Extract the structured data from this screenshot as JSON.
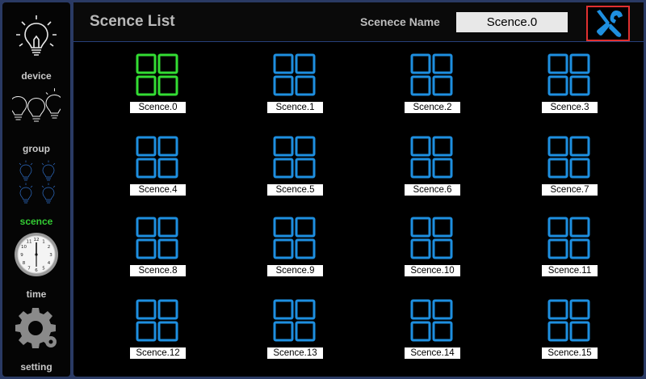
{
  "sidebar": {
    "items": [
      {
        "id": "device",
        "label": "device",
        "icon": "bulb-icon"
      },
      {
        "id": "group",
        "label": "group",
        "icon": "bulbs-group-icon"
      },
      {
        "id": "scence",
        "label": "scence",
        "icon": "scene-bulbs-icon"
      },
      {
        "id": "time",
        "label": "time",
        "icon": "clock-icon"
      },
      {
        "id": "setting",
        "label": "setting",
        "icon": "gear-icon"
      }
    ],
    "active": "scence"
  },
  "header": {
    "title": "Scence List",
    "name_label": "Scenece Name",
    "name_value": "Scence.0",
    "tools_icon": "tools-icon"
  },
  "colors": {
    "active_green": "#33cc33",
    "scene_blue": "#1e8fe0",
    "selected_scene": "#33dd33",
    "tools_border": "#e03030"
  },
  "scenes": [
    {
      "label": "Scence.0",
      "selected": true
    },
    {
      "label": "Scence.1"
    },
    {
      "label": "Scence.2"
    },
    {
      "label": "Scence.3"
    },
    {
      "label": "Scence.4"
    },
    {
      "label": "Scence.5"
    },
    {
      "label": "Scence.6"
    },
    {
      "label": "Scence.7"
    },
    {
      "label": "Scence.8"
    },
    {
      "label": "Scence.9"
    },
    {
      "label": "Scence.10"
    },
    {
      "label": "Scence.11"
    },
    {
      "label": "Scence.12"
    },
    {
      "label": "Scence.13"
    },
    {
      "label": "Scence.14"
    },
    {
      "label": "Scence.15"
    }
  ]
}
